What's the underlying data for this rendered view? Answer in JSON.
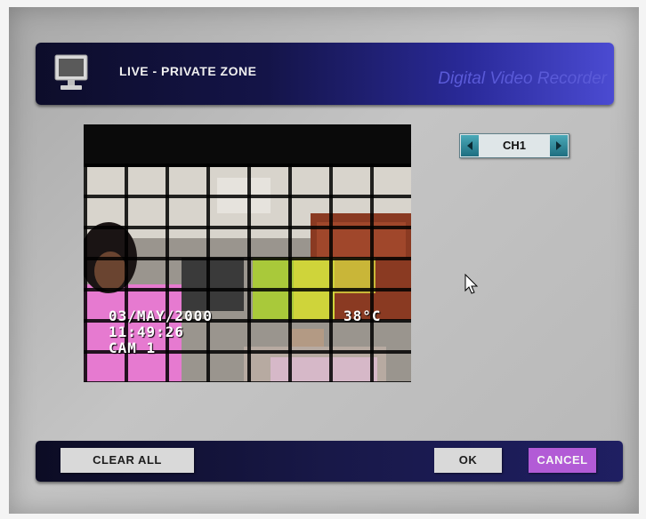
{
  "header": {
    "title": "LIVE - PRIVATE ZONE",
    "brand": "Digital Video Recorder"
  },
  "camera": {
    "osd_date": "03/MAY/2000",
    "osd_time": "11:49:26",
    "osd_camera": "CAM 1",
    "osd_temp": "38°C"
  },
  "channel_selector": {
    "value": "CH1"
  },
  "footer": {
    "clear_all": "CLEAR ALL",
    "ok": "OK",
    "cancel": "CANCEL"
  },
  "colors": {
    "header_gradient_end": "#4b4bd2",
    "brand_text": "#5a5ad8",
    "cancel_button": "#b25bd6",
    "arrow_button": "#1e6e80"
  },
  "icons": {
    "header": "monitor-icon",
    "prev": "triangle-left-icon",
    "next": "triangle-right-icon",
    "pointer": "mouse-cursor-icon"
  }
}
